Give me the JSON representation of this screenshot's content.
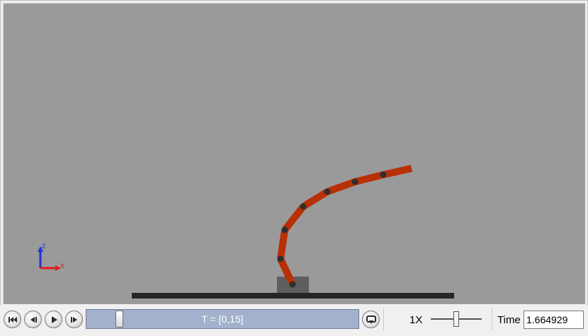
{
  "timeline": {
    "range_label": "T = [0,15]",
    "position_fraction": 0.11
  },
  "speed": {
    "label": "1X"
  },
  "time": {
    "label": "Time",
    "value": "1.664929"
  },
  "triad": {
    "z_label": "Z",
    "x_label": "X"
  },
  "colors": {
    "viewport_background": "#9a9a9a",
    "link": "#b83006",
    "joint": "#2e2e2e",
    "ground": "#262626",
    "base": "#5e5e5e",
    "axis_z": "#1e33d6",
    "axis_x": "#e01b1b"
  },
  "icons": [
    "rewind-icon",
    "step-back-icon",
    "play-icon",
    "step-forward-icon",
    "loop-icon"
  ]
}
